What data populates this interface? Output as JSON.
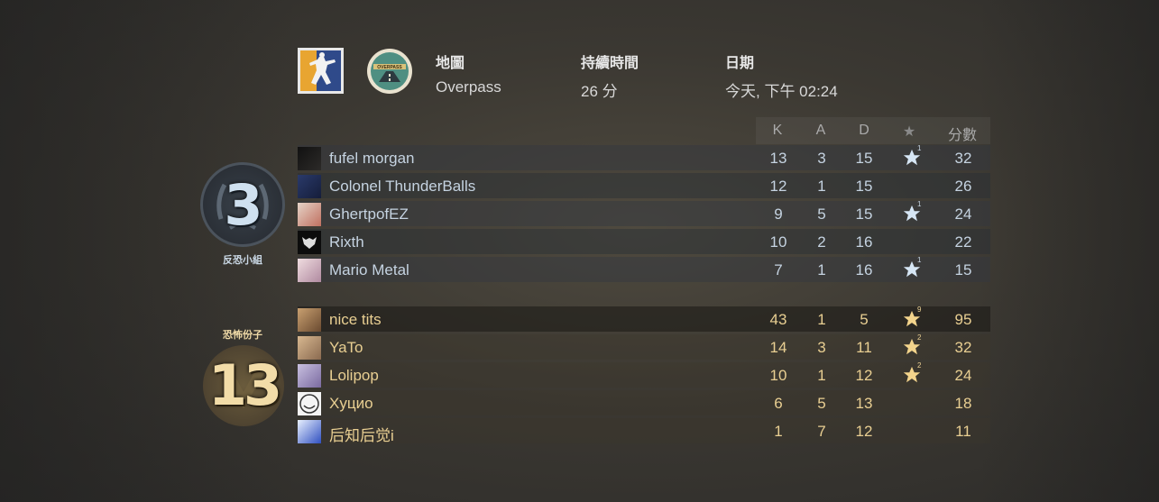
{
  "header": {
    "map_label": "地圖",
    "map_value": "Overpass",
    "duration_label": "持續時間",
    "duration_value": "26 分",
    "date_label": "日期",
    "date_value": "今天, 下午 02:24",
    "map_icon_text": "OVERPASS"
  },
  "columns": {
    "k": "K",
    "a": "A",
    "d": "D",
    "mvp": "★",
    "score": "分數"
  },
  "ct_team": {
    "name": "反恐小組",
    "score": "3",
    "color": "#c5d3e1",
    "players": [
      {
        "name": "fufel morgan",
        "k": "13",
        "a": "3",
        "d": "15",
        "mvp": "1",
        "score": "32"
      },
      {
        "name": "Colonel ThunderBalls",
        "k": "12",
        "a": "1",
        "d": "15",
        "mvp": "",
        "score": "26"
      },
      {
        "name": "GhertpofEZ",
        "k": "9",
        "a": "5",
        "d": "15",
        "mvp": "1",
        "score": "24"
      },
      {
        "name": "Rixth",
        "k": "10",
        "a": "2",
        "d": "16",
        "mvp": "",
        "score": "22"
      },
      {
        "name": "Mario Metal",
        "k": "7",
        "a": "1",
        "d": "16",
        "mvp": "1",
        "score": "15"
      }
    ]
  },
  "t_team": {
    "name": "恐怖份子",
    "score": "13",
    "color": "#e9cf92",
    "players": [
      {
        "name": "nice tits",
        "k": "43",
        "a": "1",
        "d": "5",
        "mvp": "9",
        "score": "95"
      },
      {
        "name": "YaTo",
        "k": "14",
        "a": "3",
        "d": "11",
        "mvp": "2",
        "score": "32"
      },
      {
        "name": "Lolipop",
        "k": "10",
        "a": "1",
        "d": "12",
        "mvp": "2",
        "score": "24"
      },
      {
        "name": "Xyцио",
        "k": "6",
        "a": "5",
        "d": "13",
        "mvp": "",
        "score": "18"
      },
      {
        "name": "后知后觉i",
        "k": "1",
        "a": "7",
        "d": "12",
        "mvp": "",
        "score": "11"
      }
    ]
  }
}
